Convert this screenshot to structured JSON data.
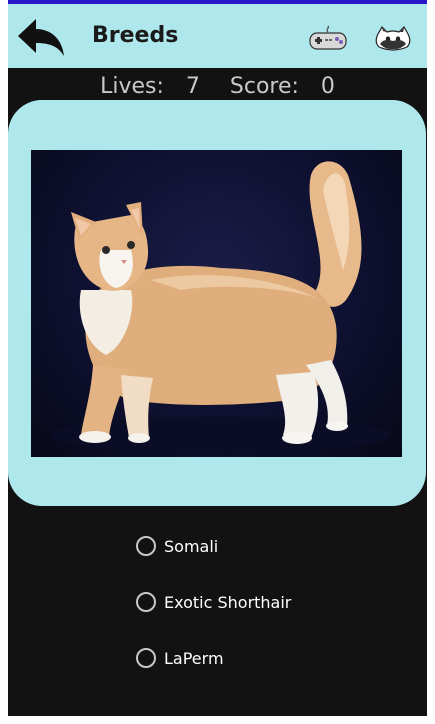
{
  "header": {
    "title": "Breeds",
    "back_icon": "back-arrow-icon",
    "game_icon": "gamepad-icon",
    "cat_icon": "cat-face-icon"
  },
  "status": {
    "lives_label": "Lives:",
    "lives_value": "7",
    "score_label": "Score:",
    "score_value": "0"
  },
  "quiz": {
    "options": [
      {
        "label": "Somali"
      },
      {
        "label": "Exotic Shorthair"
      },
      {
        "label": "LaPerm"
      }
    ]
  },
  "colors": {
    "appbar": "#aee8ec",
    "background": "#121212",
    "card": "#aee8ec",
    "top_accent": "#2a16c9"
  }
}
